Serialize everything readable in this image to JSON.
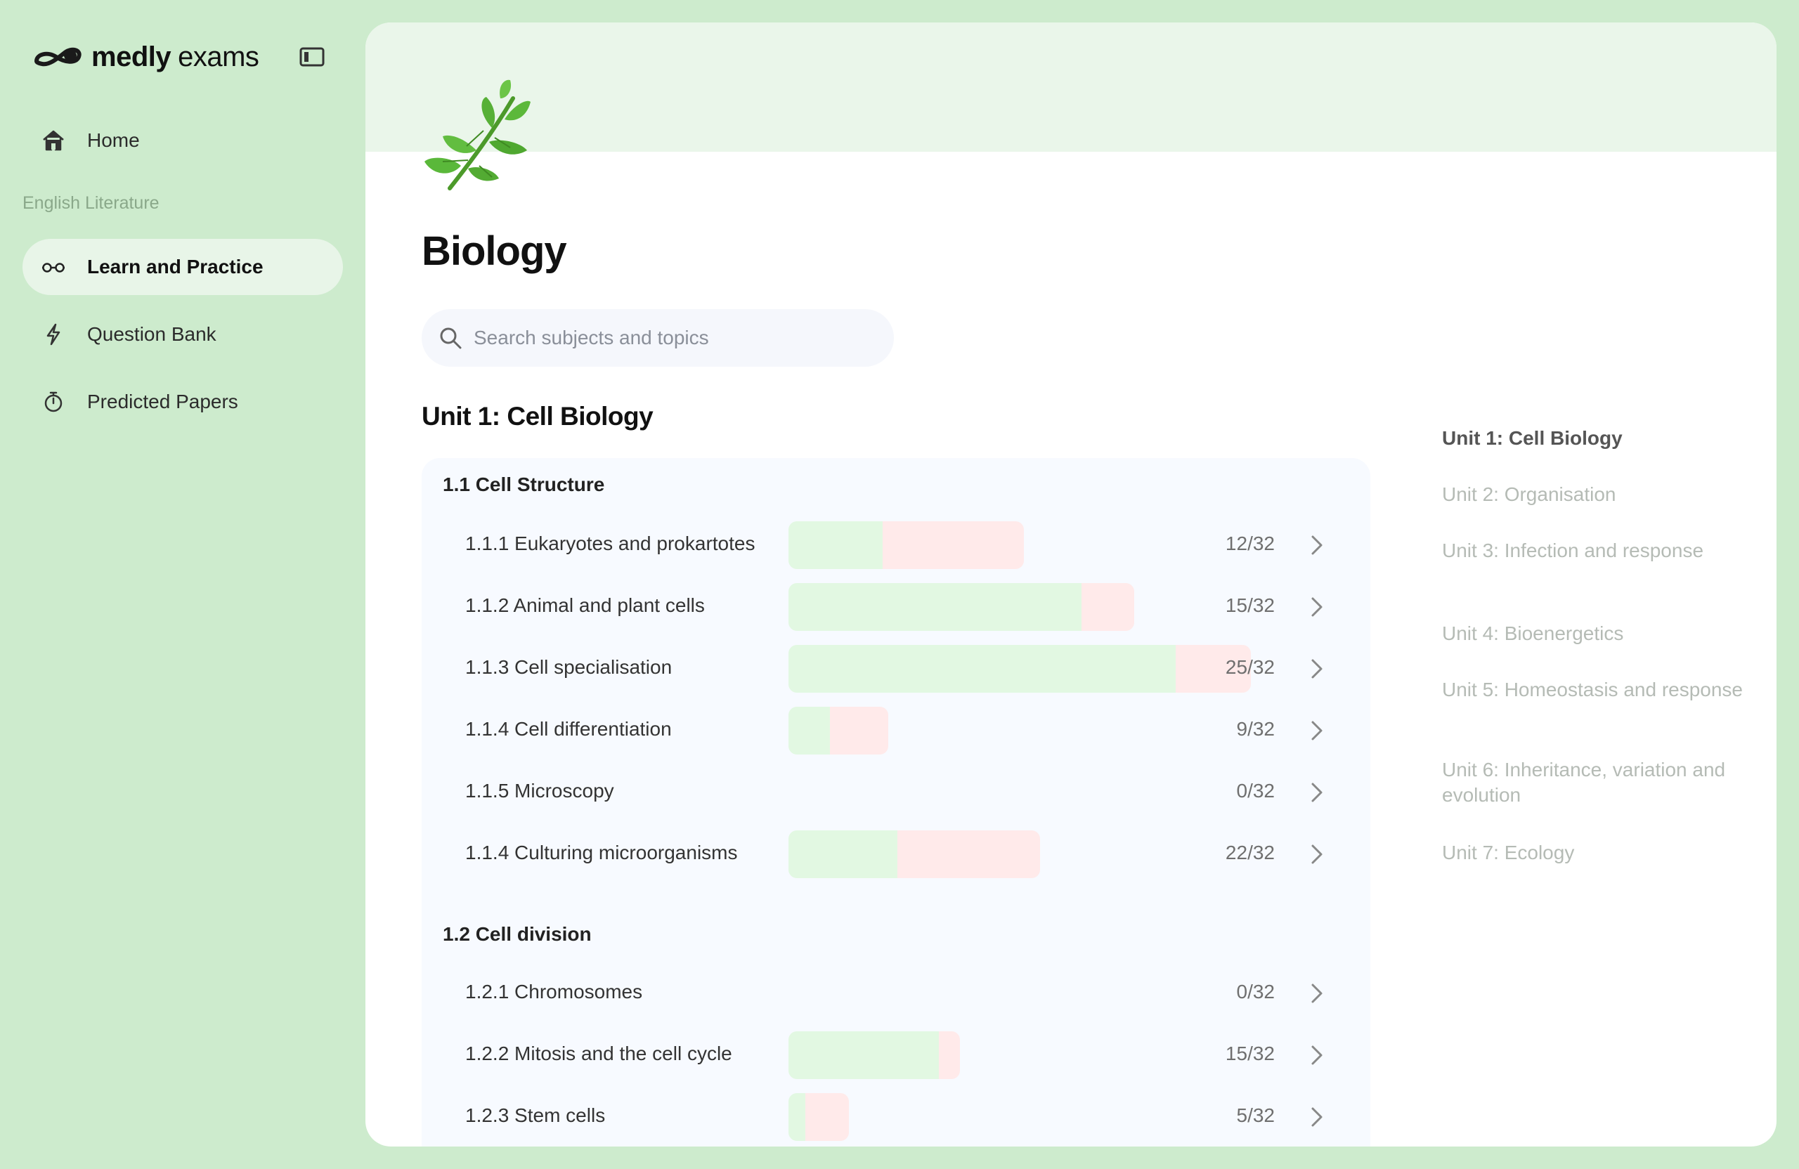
{
  "brand": {
    "bold": "medly",
    "light": "exams"
  },
  "nav": {
    "home": "Home",
    "section_label": "English Literature",
    "items": [
      {
        "label": "Learn and Practice",
        "icon": "glasses-icon",
        "active": true
      },
      {
        "label": "Question Bank",
        "icon": "lightning-icon"
      },
      {
        "label": "Predicted Papers",
        "icon": "stopwatch-icon"
      }
    ]
  },
  "page": {
    "title": "Biology",
    "search_placeholder": "Search subjects and topics",
    "unit_heading": "Unit 1: Cell Biology"
  },
  "colors": {
    "background": "#cdebcd",
    "banner": "#eaf6ea",
    "progress_correct": "#e2f8e2",
    "progress_incorrect": "#ffeaea",
    "active_nav": "#e8f5e8"
  },
  "sections": [
    {
      "title": "1.1 Cell Structure",
      "topics": [
        {
          "label": "1.1.1 Eukaryotes and prokartotes",
          "score": "12/32",
          "correct_fraction": 0.125,
          "incorrect_fraction": 0.1875
        },
        {
          "label": "1.1.2 Animal and plant cells",
          "score": "15/32",
          "correct_fraction": 0.39,
          "incorrect_fraction": 0.07
        },
        {
          "label": "1.1.3 Cell specialisation",
          "score": "25/32",
          "correct_fraction": 0.515,
          "incorrect_fraction": 0.1
        },
        {
          "label": "1.1.4 Cell differentiation",
          "score": "9/32",
          "correct_fraction": 0.055,
          "incorrect_fraction": 0.078
        },
        {
          "label": "1.1.5 Microscopy",
          "score": "0/32",
          "correct_fraction": 0,
          "incorrect_fraction": 0
        },
        {
          "label": "1.1.4 Culturing microorganisms",
          "score": "22/32",
          "correct_fraction": 0.145,
          "incorrect_fraction": 0.19
        }
      ]
    },
    {
      "title": "1.2 Cell division",
      "topics": [
        {
          "label": "1.2.1 Chromosomes",
          "score": "0/32",
          "correct_fraction": 0,
          "incorrect_fraction": 0
        },
        {
          "label": "1.2.2 Mitosis and the cell cycle",
          "score": "15/32",
          "correct_fraction": 0.2,
          "incorrect_fraction": 0.028
        },
        {
          "label": "1.2.3 Stem cells",
          "score": "5/32",
          "correct_fraction": 0.022,
          "incorrect_fraction": 0.058
        }
      ]
    }
  ],
  "outline": [
    {
      "label": "Unit 1: Cell Biology",
      "active": true
    },
    {
      "label": "Unit 2: Organisation"
    },
    {
      "label": "Unit 3: Infection and response"
    },
    {
      "label": "Unit 4: Bioenergetics"
    },
    {
      "label": "Unit 5: Homeostasis and response"
    },
    {
      "label": "Unit 6: Inheritance, variation and evolution"
    },
    {
      "label": "Unit 7: Ecology"
    }
  ]
}
